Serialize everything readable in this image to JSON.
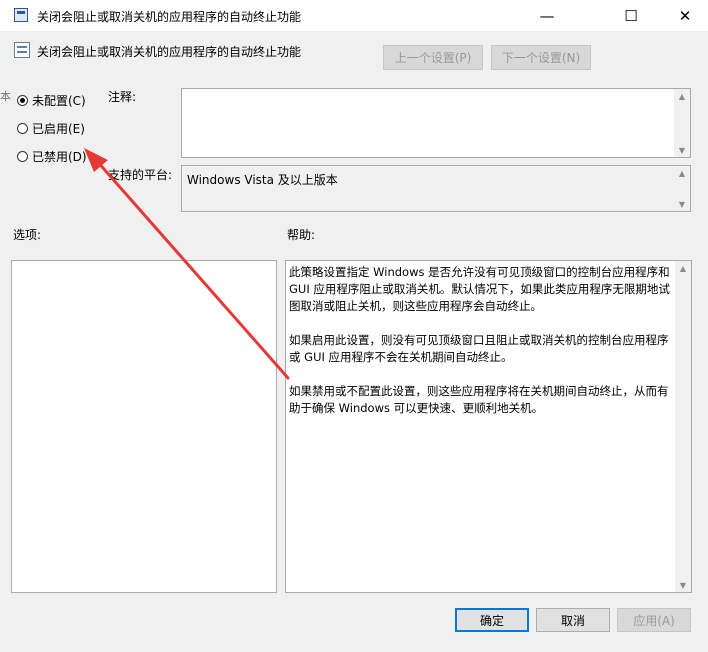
{
  "window": {
    "title": "关闭会阻止或取消关机的应用程序的自动终止功能",
    "minimize": "—",
    "maximize": "☐",
    "close": "✕"
  },
  "header": {
    "policy_name": "关闭会阻止或取消关机的应用程序的自动终止功能",
    "prev_setting": "上一个设置(P)",
    "next_setting": "下一个设置(N)"
  },
  "radios": [
    {
      "label": "未配置(C)",
      "checked": true
    },
    {
      "label": "已启用(E)",
      "checked": false
    },
    {
      "label": "已禁用(D)",
      "checked": false
    }
  ],
  "comment": {
    "label": "注释:",
    "value": ""
  },
  "supported": {
    "label": "支持的平台:",
    "value": "Windows Vista 及以上版本"
  },
  "options": {
    "label": "选项:"
  },
  "help": {
    "label": "帮助:",
    "paragraphs": [
      "此策略设置指定 Windows 是否允许没有可见顶级窗口的控制台应用程序和 GUI 应用程序阻止或取消关机。默认情况下，如果此类应用程序无限期地试图取消或阻止关机，则这些应用程序会自动终止。",
      "如果启用此设置，则没有可见顶级窗口且阻止或取消关机的控制台应用程序或 GUI 应用程序不会在关机期间自动终止。",
      "如果禁用或不配置此设置，则这些应用程序将在关机期间自动终止，从而有助于确保 Windows 可以更快速、更顺利地关机。"
    ]
  },
  "footer": {
    "ok": "确定",
    "cancel": "取消",
    "apply": "应用(A)"
  },
  "annotation_color": "#e53935"
}
